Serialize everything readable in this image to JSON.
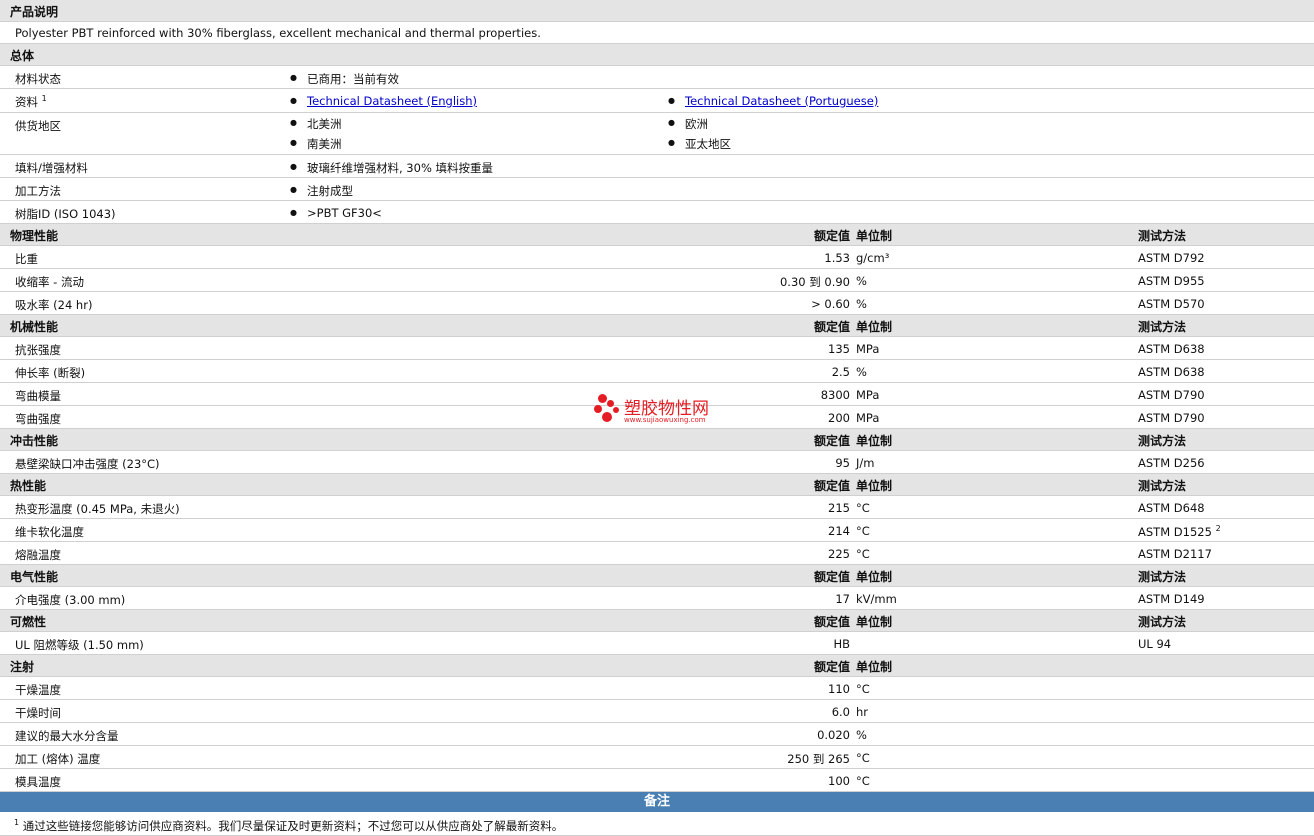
{
  "description": {
    "title": "产品说明",
    "text": "Polyester PBT reinforced with 30% fiberglass, excellent mechanical and thermal properties."
  },
  "general": {
    "title": "总体",
    "status_label": "材料状态",
    "status_value": "已商用：当前有效",
    "docs_label": "资料",
    "docs_sup": "1",
    "doc1": "Technical Datasheet (English)",
    "doc2": "Technical Datasheet (Portuguese)",
    "region_label": "供货地区",
    "regions": [
      "北美洲",
      "欧洲",
      "南美洲",
      "亚太地区"
    ],
    "filler_label": "填料/增强材料",
    "filler_value": "玻璃纤维增强材料, 30% 填料按重量",
    "process_label": "加工方法",
    "process_value": "注射成型",
    "resin_label": "树脂ID (ISO 1043)",
    "resin_value": ">PBT GF30<"
  },
  "headers": {
    "value": "额定值",
    "unit": "单位制",
    "method": "测试方法"
  },
  "physical": {
    "title": "物理性能",
    "rows": [
      {
        "label": "比重",
        "value": "1.53",
        "unit": "g/cm³",
        "method": "ASTM D792"
      },
      {
        "label": "收缩率 - 流动",
        "value": "0.30 到  0.90",
        "unit": "%",
        "method": "ASTM D955"
      },
      {
        "label": "吸水率 (24 hr)",
        "value": "> 0.60",
        "unit": "%",
        "method": "ASTM D570"
      }
    ]
  },
  "mechanical": {
    "title": "机械性能",
    "rows": [
      {
        "label": "抗张强度",
        "value": "135",
        "unit": "MPa",
        "method": "ASTM D638"
      },
      {
        "label": "伸长率 (断裂)",
        "value": "2.5",
        "unit": "%",
        "method": "ASTM D638"
      },
      {
        "label": "弯曲模量",
        "value": "8300",
        "unit": "MPa",
        "method": "ASTM D790"
      },
      {
        "label": "弯曲强度",
        "value": "200",
        "unit": "MPa",
        "method": "ASTM D790"
      }
    ]
  },
  "impact": {
    "title": "冲击性能",
    "rows": [
      {
        "label": "悬壁梁缺口冲击强度 (23°C)",
        "value": "95",
        "unit": "J/m",
        "method": "ASTM D256"
      }
    ]
  },
  "thermal": {
    "title": "热性能",
    "rows": [
      {
        "label": "热变形温度 (0.45 MPa, 未退火)",
        "value": "215",
        "unit": "°C",
        "method": "ASTM D648"
      },
      {
        "label": "维卡软化温度",
        "value": "214",
        "unit": "°C",
        "method": "ASTM D1525",
        "sup": "2"
      },
      {
        "label": "熔融温度",
        "value": "225",
        "unit": "°C",
        "method": "ASTM D2117"
      }
    ]
  },
  "electrical": {
    "title": "电气性能",
    "rows": [
      {
        "label": "介电强度 (3.00 mm)",
        "value": "17",
        "unit": "kV/mm",
        "method": "ASTM D149"
      }
    ]
  },
  "flammability": {
    "title": "可燃性",
    "rows": [
      {
        "label": "UL 阻燃等级 (1.50 mm)",
        "value": "HB",
        "unit": "",
        "method": "UL 94"
      }
    ]
  },
  "injection": {
    "title": "注射",
    "rows": [
      {
        "label": "干燥温度",
        "value": "110",
        "unit": "°C",
        "method": ""
      },
      {
        "label": "干燥时间",
        "value": "6.0",
        "unit": "hr",
        "method": ""
      },
      {
        "label": "建议的最大水分含量",
        "value": "0.020",
        "unit": "%",
        "method": ""
      },
      {
        "label": "加工 (熔体) 温度",
        "value": "250 到  265",
        "unit": "°C",
        "method": ""
      },
      {
        "label": "模具温度",
        "value": "100",
        "unit": "°C",
        "method": ""
      }
    ]
  },
  "notes": {
    "title": "备注",
    "note1_sup": "1",
    "note1": "通过这些链接您能够访问供应商资料。我们尽量保证及时更新资料；不过您可以从供应商处了解最新资料。"
  },
  "watermark": {
    "title": "塑胶物性网",
    "url": "www.sujiaowuxing.com",
    "color": "#e51c23"
  }
}
